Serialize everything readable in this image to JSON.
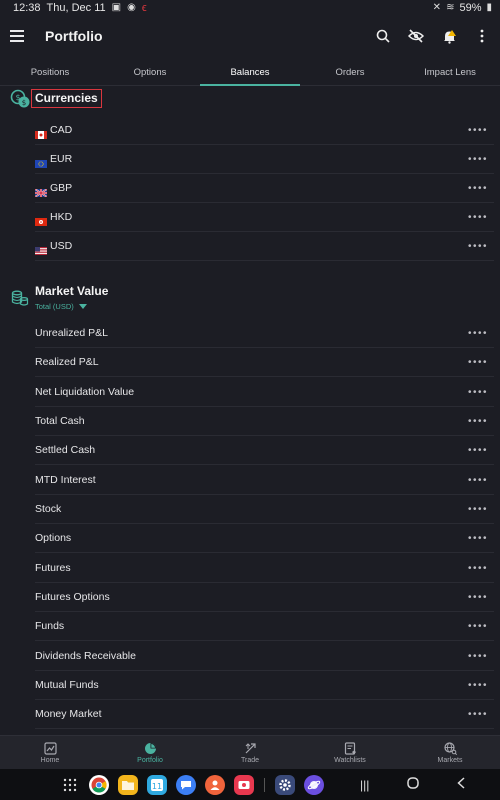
{
  "status_bar": {
    "time": "12:38",
    "date": "Thu, Dec 11",
    "battery": "59%"
  },
  "app_bar": {
    "title": "Portfolio",
    "actions": [
      "search-icon",
      "hide-eye-icon",
      "alert-bell-icon",
      "more-vertical-icon"
    ]
  },
  "tabs": [
    {
      "label": "Positions",
      "active": false
    },
    {
      "label": "Options",
      "active": false
    },
    {
      "label": "Balances",
      "active": true
    },
    {
      "label": "Orders",
      "active": false
    },
    {
      "label": "Impact Lens",
      "active": false
    }
  ],
  "currencies": {
    "title": "Currencies",
    "items": [
      {
        "code": "CAD",
        "flag": "ca-flag-icon"
      },
      {
        "code": "EUR",
        "flag": "eu-flag-icon"
      },
      {
        "code": "GBP",
        "flag": "gb-flag-icon"
      },
      {
        "code": "HKD",
        "flag": "hk-flag-icon"
      },
      {
        "code": "USD",
        "flag": "us-flag-icon"
      }
    ]
  },
  "market_value": {
    "title": "Market Value",
    "selector": "Total (USD)",
    "items": [
      "Unrealized P&L",
      "Realized P&L",
      "Net Liquidation Value",
      "Total Cash",
      "Settled Cash",
      "MTD Interest",
      "Stock",
      "Options",
      "Futures",
      "Futures Options",
      "Funds",
      "Dividends Receivable",
      "Mutual Funds",
      "Money Market"
    ]
  },
  "more_glyph": "••••",
  "bottom_nav": [
    {
      "label": "Home",
      "icon": "chart-home-icon",
      "active": false
    },
    {
      "label": "Portfolio",
      "icon": "pie-chart-icon",
      "active": true
    },
    {
      "label": "Trade",
      "icon": "trade-arrows-icon",
      "active": false
    },
    {
      "label": "Watchlists",
      "icon": "watchlist-icon",
      "active": false
    },
    {
      "label": "Markets",
      "icon": "globe-search-icon",
      "active": false
    }
  ],
  "colors": {
    "background": "#1c1d24",
    "accent": "#4ab3a0",
    "highlight_box": "#d9363e"
  }
}
